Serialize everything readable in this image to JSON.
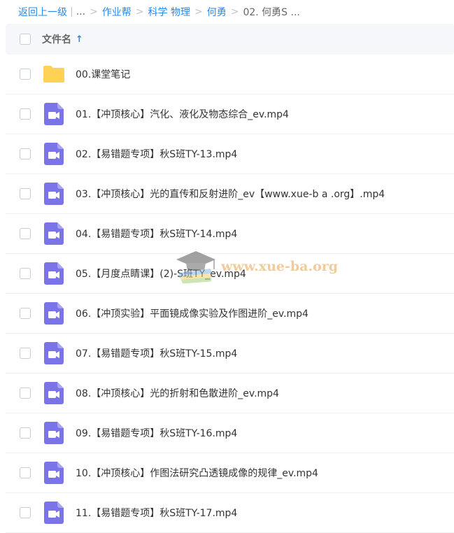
{
  "breadcrumb": {
    "back": "返回上一级",
    "sep_pipe": "|",
    "ellipsis": "...",
    "items": [
      "作业帮",
      "科学 物理",
      "何勇"
    ],
    "current": "02. 何勇S ...",
    "separator": ">"
  },
  "header": {
    "column_label": "文件名",
    "sort_indicator": "↑"
  },
  "colors": {
    "accent": "#2b8ae6",
    "folder": "#ffd154",
    "video": "#7a74e8"
  },
  "files": [
    {
      "name": "00.课堂笔记",
      "icon": "folder-icon"
    },
    {
      "name": "01.【冲顶核心】汽化、液化及物态综合_ev.mp4",
      "icon": "video-icon"
    },
    {
      "name": "02.【易错题专项】秋S班TY-13.mp4",
      "icon": "video-icon"
    },
    {
      "name": "03.【冲顶核心】光的直传和反射进阶_ev【www.xue-b a .org】.mp4",
      "icon": "video-icon"
    },
    {
      "name": "04.【易错题专项】秋S班TY-14.mp4",
      "icon": "video-icon"
    },
    {
      "name": "05.【月度点睛课】(2)-S班TY_ev.mp4",
      "icon": "video-icon"
    },
    {
      "name": "06.【冲顶实验】平面镜成像实验及作图进阶_ev.mp4",
      "icon": "video-icon"
    },
    {
      "name": "07.【易错题专项】秋S班TY-15.mp4",
      "icon": "video-icon"
    },
    {
      "name": "08.【冲顶核心】光的折射和色散进阶_ev.mp4",
      "icon": "video-icon"
    },
    {
      "name": "09.【易错题专项】秋S班TY-16.mp4",
      "icon": "video-icon"
    },
    {
      "name": "10.【冲顶核心】作图法研究凸透镜成像的规律_ev.mp4",
      "icon": "video-icon"
    },
    {
      "name": "11.【易错题专项】秋S班TY-17.mp4",
      "icon": "video-icon"
    }
  ],
  "watermark": {
    "text": "www.xue-ba.org"
  }
}
